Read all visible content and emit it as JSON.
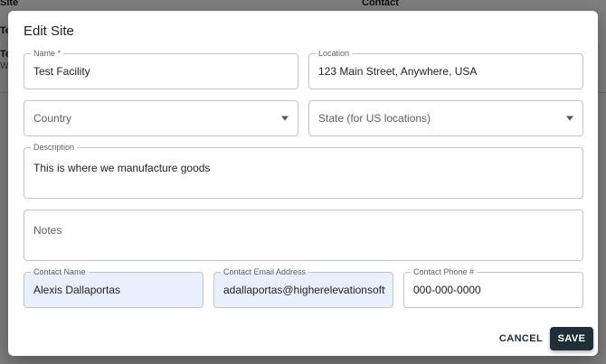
{
  "background": {
    "col_site": "Site",
    "col_contact": "Contact",
    "row1_name": "Te",
    "row2_name": "Te",
    "row2_sub": "Wo"
  },
  "dialog": {
    "title": "Edit Site",
    "fields": {
      "name": {
        "label": "Name *",
        "value": "Test Facility"
      },
      "location": {
        "label": "Location",
        "value": "123 Main Street, Anywhere, USA"
      },
      "country": {
        "placeholder": "Country"
      },
      "state": {
        "placeholder": "State (for US locations)"
      },
      "description": {
        "label": "Description",
        "value": "This is where we manufacture goods"
      },
      "notes": {
        "placeholder": "Notes"
      },
      "contact_name": {
        "label": "Contact Name",
        "value": "Alexis Dallaportas"
      },
      "contact_email": {
        "label": "Contact Email Address",
        "value": "adallaportas@higherelevationsoftw"
      },
      "contact_phone": {
        "label": "Contact Phone #",
        "value": "000-000-0000"
      }
    },
    "actions": {
      "cancel_label": "CANCEL",
      "save_label": "SAVE"
    }
  },
  "colors": {
    "save_button": "#1e2f3a",
    "autofill_background": "#e8f0fe"
  }
}
